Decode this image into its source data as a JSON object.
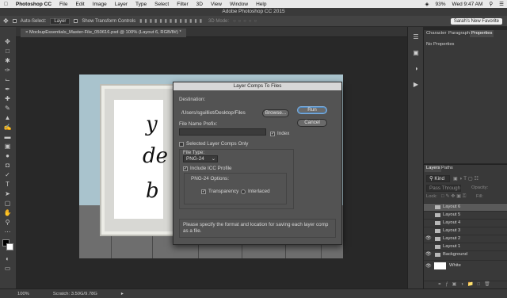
{
  "menubar": {
    "apple": "",
    "app": "Photoshop CC",
    "items": [
      "File",
      "Edit",
      "Image",
      "Layer",
      "Type",
      "Select",
      "Filter",
      "3D",
      "View",
      "Window",
      "Help"
    ],
    "battery": "93%",
    "clock": "Wed 9:47 AM"
  },
  "window": {
    "title": "Adobe Photoshop CC 2015"
  },
  "options": {
    "auto_select": "Auto-Select:",
    "target": "Layer",
    "show_transform": "Show Transform Controls",
    "mode_3d": "3D Mode:",
    "workspace": "Sarah's New Favorite"
  },
  "document": {
    "tab": "MockupEssentials_Master-File_050616.psd @ 100% (Layout 6, RGB/8#) *",
    "script_lines": [
      "y",
      "de",
      "b"
    ]
  },
  "dialog": {
    "title": "Layer Comps To Files",
    "destination_label": "Destination:",
    "destination_value": "/Users/sguilliot/Desktop/Files",
    "browse": "Browse...",
    "run": "Run",
    "cancel": "Cancel",
    "prefix_label": "File Name Prefix:",
    "prefix_value": "",
    "index": "Index",
    "selected_comps": "Selected Layer Comps Only",
    "file_type_label": "File Type:",
    "file_type_value": "PNG-24",
    "include_icc": "Include ICC Profile",
    "png_options": "PNG-24 Options:",
    "transparency": "Transparency",
    "interlaced": "Interlaced",
    "message": "Please specify the format and location for saving each layer comp as a file."
  },
  "panels": {
    "tabs": [
      "Character",
      "Paragraph",
      "Properties"
    ],
    "no_properties": "No Properties",
    "layers_tabs": [
      "Layers",
      "Paths"
    ],
    "kind": "Kind",
    "blend": "Pass Through",
    "opacity": "Opacity:",
    "lock": "Lock:",
    "fill": "Fill:",
    "layers": [
      {
        "name": "Layout 6",
        "visible": false,
        "selected": true
      },
      {
        "name": "Layout 5",
        "visible": false,
        "selected": false
      },
      {
        "name": "Layout 4",
        "visible": false,
        "selected": false
      },
      {
        "name": "Layout 3",
        "visible": false,
        "selected": false
      },
      {
        "name": "Layout 2",
        "visible": true,
        "selected": false
      },
      {
        "name": "Layout 1",
        "visible": false,
        "selected": false
      },
      {
        "name": "Background",
        "visible": true,
        "selected": false
      },
      {
        "name": "White",
        "visible": true,
        "selected": false
      }
    ]
  },
  "status": {
    "zoom": "100%",
    "doc": "Scratch: 3.50G/9.78G"
  }
}
